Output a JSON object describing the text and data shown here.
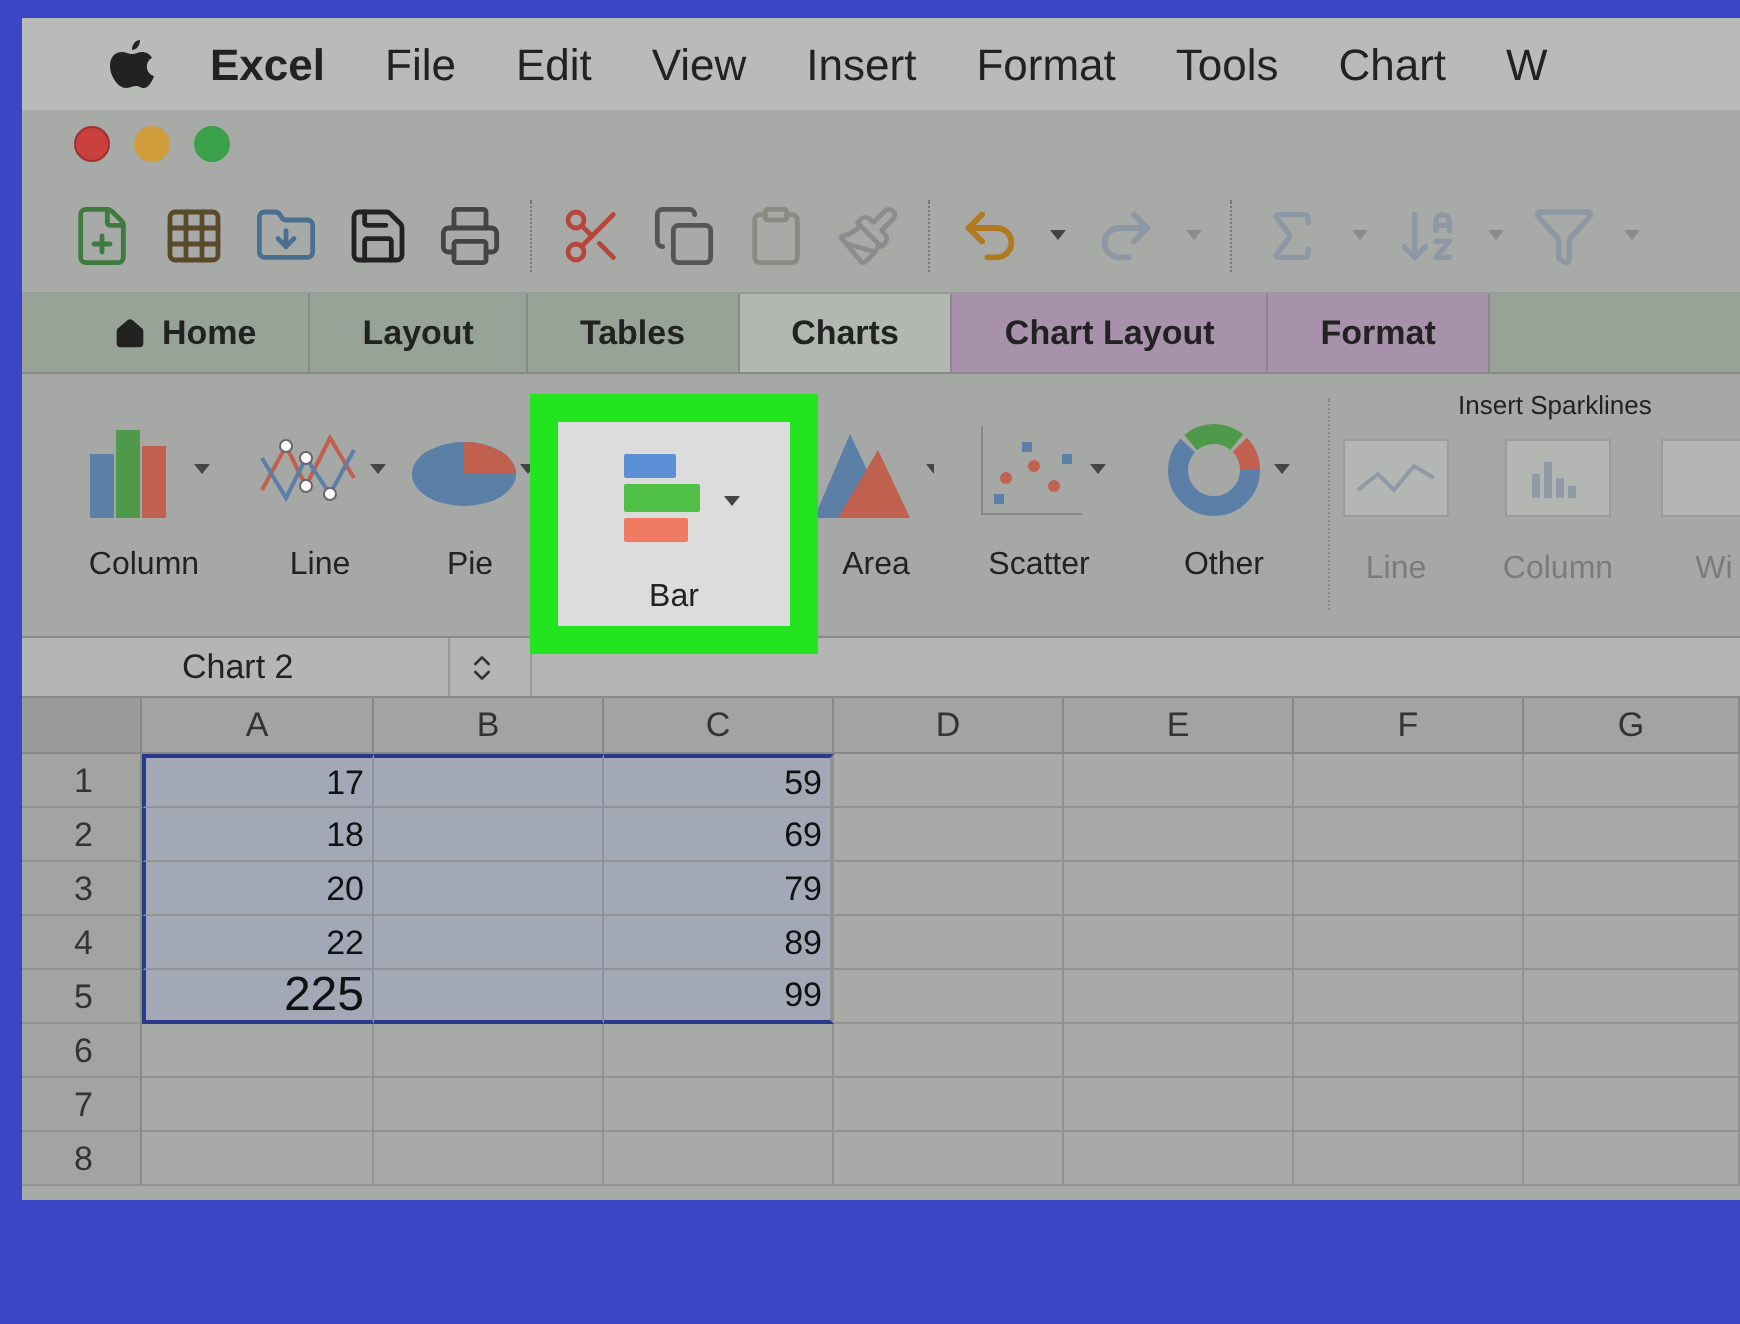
{
  "menu_bar": {
    "app_name": "Excel",
    "items": [
      "File",
      "Edit",
      "View",
      "Insert",
      "Format",
      "Tools",
      "Chart",
      "W"
    ]
  },
  "tabs": [
    {
      "label": "Home",
      "kind": "home",
      "selected": false
    },
    {
      "label": "Layout",
      "kind": "standard",
      "selected": false
    },
    {
      "label": "Tables",
      "kind": "standard",
      "selected": false
    },
    {
      "label": "Charts",
      "kind": "standard",
      "selected": true
    },
    {
      "label": "Chart Layout",
      "kind": "contextual",
      "selected": false
    },
    {
      "label": "Format",
      "kind": "contextual",
      "selected": false
    }
  ],
  "ribbon": {
    "chart_types": [
      {
        "label": "Column",
        "kind": "column",
        "highlighted": false
      },
      {
        "label": "Line",
        "kind": "line",
        "highlighted": false
      },
      {
        "label": "Pie",
        "kind": "pie",
        "highlighted": false
      },
      {
        "label": "Bar",
        "kind": "bar",
        "highlighted": true
      },
      {
        "label": "Area",
        "kind": "area",
        "highlighted": false
      },
      {
        "label": "Scatter",
        "kind": "scatter",
        "highlighted": false
      },
      {
        "label": "Other",
        "kind": "other",
        "highlighted": false
      }
    ],
    "sparklines": {
      "title": "Insert Sparklines",
      "items": [
        {
          "label": "Line",
          "kind": "line"
        },
        {
          "label": "Column",
          "kind": "column"
        },
        {
          "label": "Wi",
          "kind": "winloss"
        }
      ]
    }
  },
  "name_box": {
    "value": "Chart 2"
  },
  "sheet": {
    "columns": [
      "A",
      "B",
      "C",
      "D",
      "E",
      "F",
      "G"
    ],
    "rows": [
      {
        "header": "1",
        "selected": true,
        "cell_a": {
          "text": "17",
          "large": false
        },
        "cell_c": {
          "text": "59",
          "large": false
        }
      },
      {
        "header": "2",
        "selected": true,
        "cell_a": {
          "text": "18",
          "large": false
        },
        "cell_c": {
          "text": "69",
          "large": false
        }
      },
      {
        "header": "3",
        "selected": true,
        "cell_a": {
          "text": "20",
          "large": false
        },
        "cell_c": {
          "text": "79",
          "large": false
        }
      },
      {
        "header": "4",
        "selected": true,
        "cell_a": {
          "text": "22",
          "large": false
        },
        "cell_c": {
          "text": "89",
          "large": false
        }
      },
      {
        "header": "5",
        "selected": true,
        "cell_a": {
          "text": "225",
          "large": true
        },
        "cell_c": {
          "text": "99",
          "large": false
        }
      },
      {
        "header": "6",
        "selected": false
      },
      {
        "header": "7",
        "selected": false
      },
      {
        "header": "8",
        "selected": false
      }
    ]
  }
}
